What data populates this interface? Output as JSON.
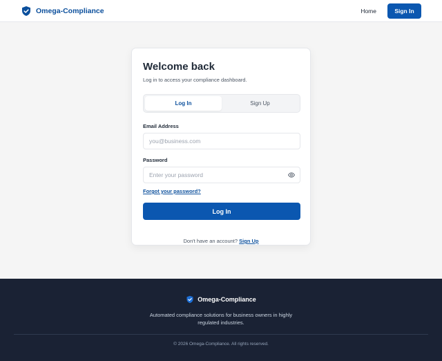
{
  "header": {
    "brand_name": "Omega-Compliance",
    "nav_home": "Home",
    "nav_signin": "Sign In"
  },
  "card": {
    "title": "Welcome back",
    "subtitle": "Log in to access your compliance dashboard.",
    "tabs": [
      {
        "label": "Log In",
        "active": true
      },
      {
        "label": "Sign Up",
        "active": false
      }
    ],
    "email": {
      "label": "Email Address",
      "placeholder": "you@business.com",
      "value": ""
    },
    "password": {
      "label": "Password",
      "placeholder": "Enter your password",
      "value": ""
    },
    "forgot_link": "Forgot your password?",
    "submit_label": "Log In",
    "signup_prompt": "Don't have an account?",
    "signup_link": "Sign Up"
  },
  "footer": {
    "brand_name": "Omega-Compliance",
    "tagline": "Automated compliance solutions for business owners in highly regulated industries.",
    "copyright": "© 2026 Omega-Compliance. All rights reserved."
  },
  "colors": {
    "brand": "#0b4f9c",
    "primary_button": "#0b57b0",
    "footer_bg": "#1a2234"
  },
  "icons": {
    "brand_logo": "shield-check-icon",
    "password_toggle": "eye-icon"
  }
}
